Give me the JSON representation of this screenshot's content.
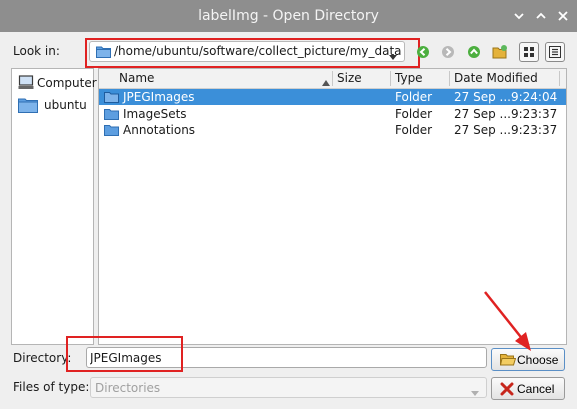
{
  "window": {
    "title": "labelImg - Open Directory",
    "controls": {
      "close": "close",
      "minimize": "minimize",
      "maximize": "maximize"
    }
  },
  "lookin": {
    "label": "Look in:",
    "path": "/home/ubuntu/software/collect_picture/my_data"
  },
  "toolbar": {
    "icons": [
      "back-icon",
      "forward-icon",
      "parent-directory-icon",
      "new-folder-icon",
      "list-view-icon",
      "detail-view-icon"
    ]
  },
  "sidebar": {
    "items": [
      {
        "label": "Computer",
        "icon": "computer-icon"
      },
      {
        "label": "ubuntu",
        "icon": "folder-icon"
      }
    ]
  },
  "filelist": {
    "columns": [
      "Name",
      "Size",
      "Type",
      "Date Modified"
    ],
    "rows": [
      {
        "name": "JPEGImages",
        "size": "",
        "type": "Folder",
        "date": "27 Sep ...9:24:04",
        "selected": true
      },
      {
        "name": "ImageSets",
        "size": "",
        "type": "Folder",
        "date": "27 Sep ...9:23:37",
        "selected": false
      },
      {
        "name": "Annotations",
        "size": "",
        "type": "Folder",
        "date": "27 Sep ...9:23:37",
        "selected": false
      }
    ]
  },
  "directory": {
    "label": "Directory:",
    "value": "JPEGImages"
  },
  "filetype": {
    "label": "Files of type:",
    "value": "Directories"
  },
  "buttons": {
    "choose": "Choose",
    "cancel": "Cancel"
  },
  "colors": {
    "selection": "#3b8fd9",
    "annotation_red": "#e02222",
    "titlebar": "#8e8e8e"
  }
}
